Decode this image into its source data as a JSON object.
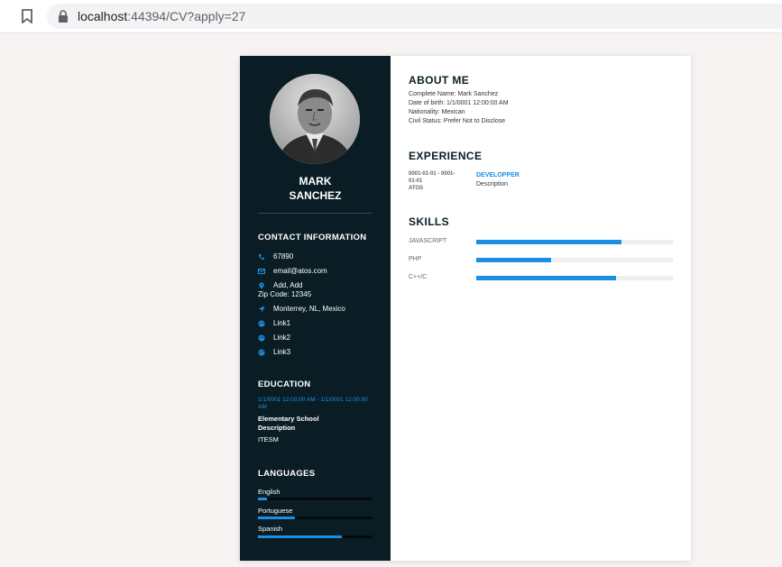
{
  "browser": {
    "url_host": "localhost",
    "url_rest": ":44394/CV?apply=27"
  },
  "profile": {
    "first_name": "MARK",
    "last_name": "SANCHEZ"
  },
  "contact": {
    "title": "CONTACT INFORMATION",
    "phone": "67890",
    "email": "email@atos.com",
    "address": "Add, Add",
    "zip": "Zip Code: 12345",
    "location": "Monterrey, NL, Mexico",
    "link1": "Link1",
    "link2": "Link2",
    "link3": "Link3"
  },
  "education": {
    "title": "EDUCATION",
    "date": "1/1/0001 12:00:00 AM - 1/1/0001 12:00:00 AM",
    "degree_line1": "Elementary School",
    "degree_line2": "Description",
    "school": "ITESM"
  },
  "languages": {
    "title": "LANGUAGES",
    "items": [
      {
        "label": "English",
        "level": 0.08
      },
      {
        "label": "Portuguese",
        "level": 0.32
      },
      {
        "label": "Spanish",
        "level": 0.73
      }
    ]
  },
  "about": {
    "title": "ABOUT ME",
    "complete_name": "Complete Name: Mark Sanchez",
    "dob": "Date of birth: 1/1/0001 12:00:00 AM",
    "nationality": "Nationality: Mexican",
    "civil_status": "Civil Status: Prefer Not to Disclose"
  },
  "experience": {
    "title": "EXPERIENCE",
    "date": "0001-01-01 - 0001-01-01",
    "company": "ATOS",
    "role": "DEVELOPPER",
    "description": "Description"
  },
  "skills": {
    "title": "SKILLS",
    "items": [
      {
        "label": "JAVASCRIPT",
        "level": 0.74
      },
      {
        "label": "PHP",
        "level": 0.38
      },
      {
        "label": "C++/C",
        "level": 0.71
      }
    ]
  },
  "colors": {
    "sidebar": "#0a1d25",
    "accent": "#1a8fe3"
  }
}
